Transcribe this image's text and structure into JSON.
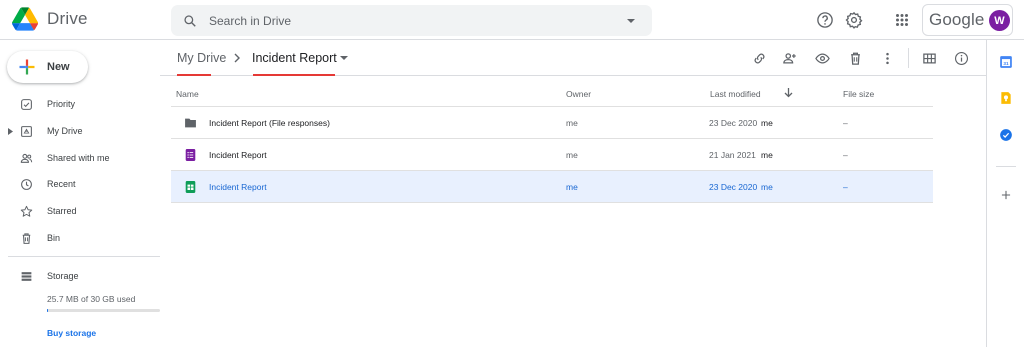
{
  "app": {
    "name": "Drive",
    "brand_word": "Google",
    "avatar_initial": "W",
    "avatar_color": "#7b1fa2"
  },
  "search": {
    "placeholder": "Search in Drive"
  },
  "topbar_icons": [
    "help-icon",
    "settings-icon",
    "apps-grid-icon"
  ],
  "sidebar": {
    "new_label": "New",
    "items": [
      {
        "label": "Priority",
        "icon": "priority-icon"
      },
      {
        "label": "My Drive",
        "icon": "my-drive-icon"
      },
      {
        "label": "Shared with me",
        "icon": "shared-icon"
      },
      {
        "label": "Recent",
        "icon": "recent-icon"
      },
      {
        "label": "Starred",
        "icon": "star-icon"
      },
      {
        "label": "Bin",
        "icon": "bin-icon"
      }
    ],
    "storage": {
      "label": "Storage",
      "used_text": "25.7 MB of 30 GB used",
      "used_fraction": 0.0009,
      "buy_label": "Buy storage"
    }
  },
  "breadcrumb": {
    "root": "My Drive",
    "current": "Incident Report"
  },
  "toolbar_icons": [
    "link-icon",
    "add-person-icon",
    "preview-icon",
    "delete-icon",
    "more-icon",
    "grid-view-icon",
    "info-icon"
  ],
  "table": {
    "headers": {
      "name": "Name",
      "owner": "Owner",
      "modified": "Last modified",
      "size": "File size"
    },
    "rows": [
      {
        "name": "Incident Report (File responses)",
        "type": "folder",
        "owner": "me",
        "modified_date": "23 Dec 2020",
        "modified_by": "me",
        "size": "–",
        "selected": false
      },
      {
        "name": "Incident Report",
        "type": "form",
        "owner": "me",
        "modified_date": "21 Jan 2021",
        "modified_by": "me",
        "size": "–",
        "selected": false
      },
      {
        "name": "Incident Report",
        "type": "sheet",
        "owner": "me",
        "modified_date": "23 Dec 2020",
        "modified_by": "me",
        "size": "–",
        "selected": true
      }
    ]
  },
  "side_panel_icons": [
    "calendar-icon",
    "keep-icon",
    "tasks-icon",
    "add-icon"
  ],
  "colors": {
    "accent": "#1a73e8",
    "selected_row": "#e8f0fe",
    "annotation_underline": "#e53935"
  }
}
